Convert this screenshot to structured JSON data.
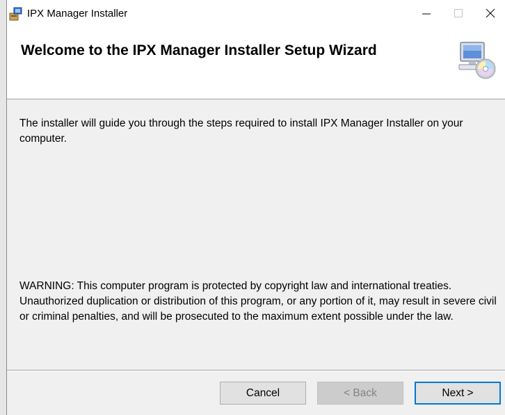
{
  "window": {
    "title": "IPX Manager Installer",
    "controls": {
      "minimize": "minimize",
      "maximize": "maximize",
      "close": "close"
    }
  },
  "banner": {
    "title": "Welcome to the IPX Manager Installer Setup Wizard",
    "icon": "setup-computer-cd-icon"
  },
  "content": {
    "intro": "The installer will guide you through the steps required to install IPX Manager Installer on your computer.",
    "warning": "WARNING: This computer program is protected by copyright law and international treaties. Unauthorized duplication or distribution of this program, or any portion of it, may result in severe civil or criminal penalties, and will be prosecuted to the maximum extent possible under the law."
  },
  "buttons": {
    "cancel": "Cancel",
    "back": "< Back",
    "next": "Next >"
  },
  "colors": {
    "accent": "#0078d7",
    "dialog_bg": "#f0f0f0",
    "banner_bg": "#ffffff"
  }
}
